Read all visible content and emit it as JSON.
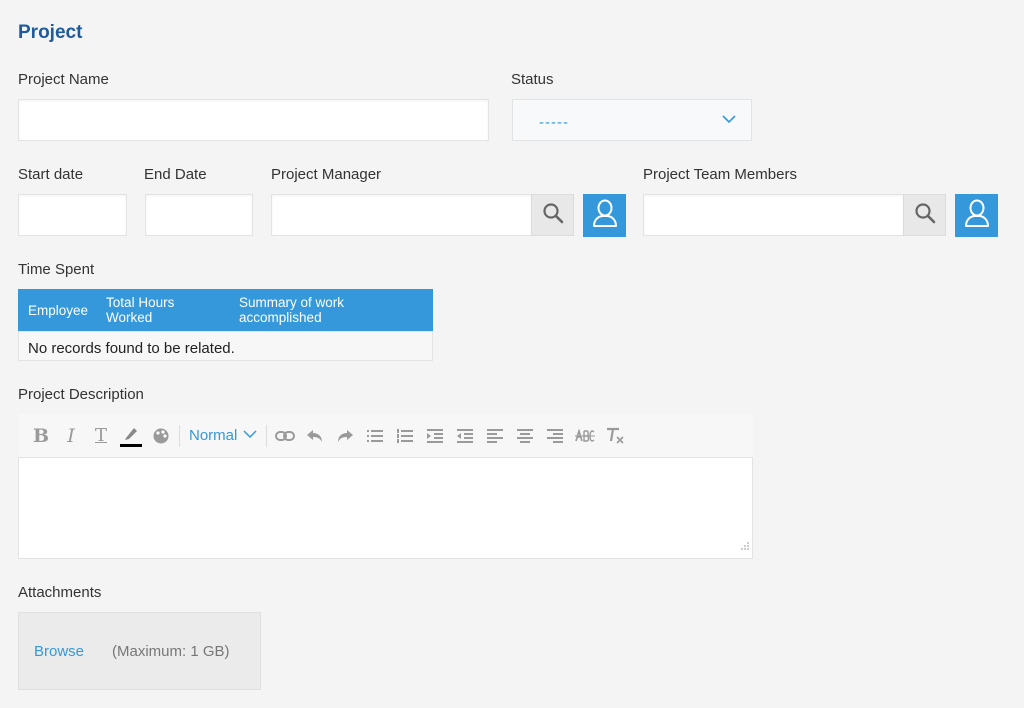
{
  "section_title": "Project",
  "fields": {
    "project_name": {
      "label": "Project Name",
      "value": ""
    },
    "status": {
      "label": "Status",
      "value": "-----"
    },
    "start_date": {
      "label": "Start date",
      "value": ""
    },
    "end_date": {
      "label": "End Date",
      "value": ""
    },
    "project_manager": {
      "label": "Project Manager",
      "value": ""
    },
    "team_members": {
      "label": "Project Team Members",
      "value": ""
    }
  },
  "time_spent": {
    "label": "Time Spent",
    "columns": [
      "Employee",
      "Total Hours Worked",
      "Summary of work accomplished"
    ],
    "empty_message": "No records found to be related."
  },
  "description": {
    "label": "Project Description",
    "font_size_option": "Normal",
    "toolbar_icons": [
      "bold-icon",
      "italic-icon",
      "text-format-icon",
      "text-color-icon",
      "background-color-icon",
      "font-size-select",
      "link-icon",
      "undo-icon",
      "redo-icon",
      "bullet-list-icon",
      "numbered-list-icon",
      "indent-icon",
      "outdent-icon",
      "align-left-icon",
      "align-center-icon",
      "align-right-icon",
      "strikethrough-icon",
      "clear-format-icon"
    ]
  },
  "attachments": {
    "label": "Attachments",
    "browse_label": "Browse",
    "max_label": "(Maximum: 1 GB)"
  },
  "colors": {
    "accent": "#3498db",
    "title": "#1f5b9c",
    "background": "#f4f4f4"
  }
}
